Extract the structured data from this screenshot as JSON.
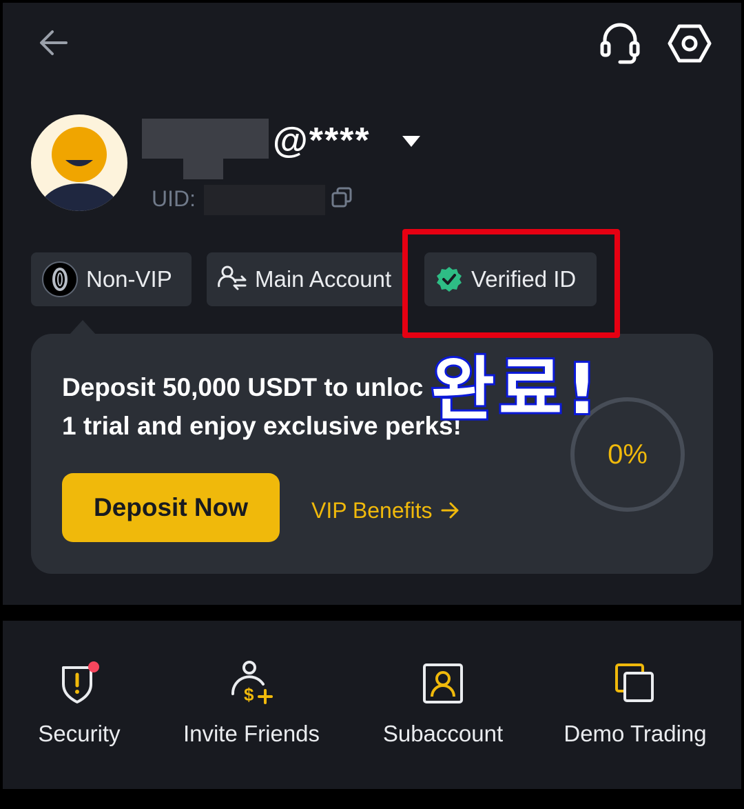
{
  "header": {
    "back_icon": "arrow-left-icon",
    "support_icon": "headset-icon",
    "settings_icon": "hexagon-settings-icon"
  },
  "profile": {
    "nickname_suffix": "@****",
    "uid_label": "UID:"
  },
  "chips": [
    {
      "label": "Non-VIP",
      "icon": "vip-badge-icon"
    },
    {
      "label": "Main Account",
      "icon": "user-switch-icon"
    },
    {
      "label": "Verified ID",
      "icon": "verified-check-icon"
    }
  ],
  "promo": {
    "line1": "Deposit 50,000 USDT to unloc",
    "line2": "1 trial and enjoy exclusive perks!",
    "deposit_button": "Deposit Now",
    "benefits_link": "VIP Benefits",
    "progress_text": "0%",
    "progress_value": 0
  },
  "overlay": {
    "text": "완료!",
    "highlight_color": "#e60012",
    "text_stroke_color": "#0c1ad8"
  },
  "quick_actions": [
    {
      "label": "Security",
      "icon": "shield-alert-icon",
      "has_notification_dot": true
    },
    {
      "label": "Invite Friends",
      "icon": "user-dollar-plus-icon"
    },
    {
      "label": "Subaccount",
      "icon": "user-square-icon"
    },
    {
      "label": "Demo Trading",
      "icon": "stacked-squares-icon"
    }
  ],
  "colors": {
    "background": "#181a20",
    "card": "#2b2f36",
    "accent": "#f0b90b",
    "verified_green": "#2ebd85",
    "notification_red": "#f6465d"
  }
}
